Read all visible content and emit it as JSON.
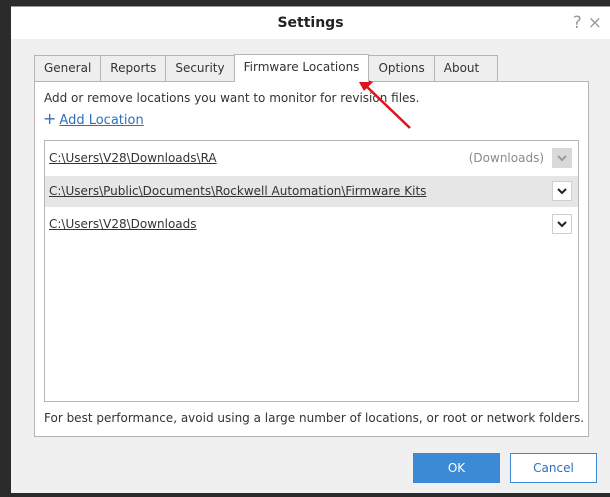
{
  "window": {
    "title": "Settings",
    "help_glyph": "?",
    "close_glyph": "×"
  },
  "tabs": [
    {
      "label": "General",
      "active": false
    },
    {
      "label": "Reports",
      "active": false
    },
    {
      "label": "Security",
      "active": false
    },
    {
      "label": "Firmware Locations",
      "active": true
    },
    {
      "label": "Options",
      "active": false
    },
    {
      "label": "About",
      "active": false
    }
  ],
  "panel": {
    "description": "Add or remove locations you want to monitor for revision files.",
    "add_location_label": "Add Location",
    "locations": [
      {
        "path": "C:\\Users\\V28\\Downloads\\RA",
        "tag": "(Downloads)",
        "selected": false,
        "dropdown_enabled": false
      },
      {
        "path": "C:\\Users\\Public\\Documents\\Rockwell Automation\\Firmware Kits",
        "tag": "",
        "selected": true,
        "dropdown_enabled": true
      },
      {
        "path": "C:\\Users\\V28\\Downloads",
        "tag": "",
        "selected": false,
        "dropdown_enabled": true
      }
    ],
    "note": "For best performance, avoid using a large number of locations, or root or network folders."
  },
  "buttons": {
    "ok_label": "OK",
    "cancel_label": "Cancel"
  },
  "colors": {
    "accent": "#3c8ad6",
    "link": "#2d6fb8",
    "annotation_arrow": "#e0141e"
  },
  "icons": {
    "add": "plus-icon",
    "dropdown": "chevron-down-icon",
    "annotation": "red-arrow-annotation"
  }
}
